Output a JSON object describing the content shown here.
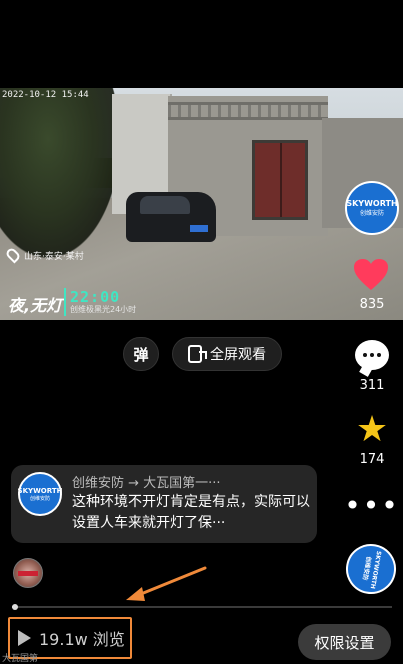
{
  "video": {
    "timestamp": "2022-10-12 15:44",
    "location": "山东·泰安·某村",
    "night_title": "夜,无灯",
    "clock": "22:00",
    "tagline": "创维极黑光24小时",
    "brand_badge_line1": "SKYWORTH",
    "brand_badge_line2": "创维安防"
  },
  "likes": {
    "count": "835"
  },
  "actions": {
    "danmu_label": "弹",
    "fullscreen_label": "全屏观看"
  },
  "rail": {
    "comments_count": "311",
    "favorites_count": "174",
    "more_label": "•••"
  },
  "comment": {
    "avatar_line1": "SKYWORTH",
    "avatar_line2": "创维安防",
    "header": "创维安防 → 大瓦国第一···",
    "text": "这种环境不开灯肯定是有点，实际可以设置人车来就开灯了保···"
  },
  "brand_small": {
    "text": "SKYWORTH 创维安防"
  },
  "progress": {
    "fraction": 0.005
  },
  "footer": {
    "views": "19.1w 浏览",
    "watermark": "大瓦国第",
    "permission_button": "权限设置"
  },
  "colors": {
    "accent_orange": "#f08a3a",
    "brand_blue": "#1a6fd1",
    "clock_green": "#3fe6c3",
    "heart_red": "#ff3b5c",
    "star_yellow": "#f5c518"
  },
  "icons": {
    "play": "play-icon",
    "heart": "heart-icon",
    "comment": "comment-icon",
    "star": "star-icon",
    "more": "more-icon",
    "fullscreen": "fullscreen-icon",
    "location": "location-pin-icon"
  }
}
